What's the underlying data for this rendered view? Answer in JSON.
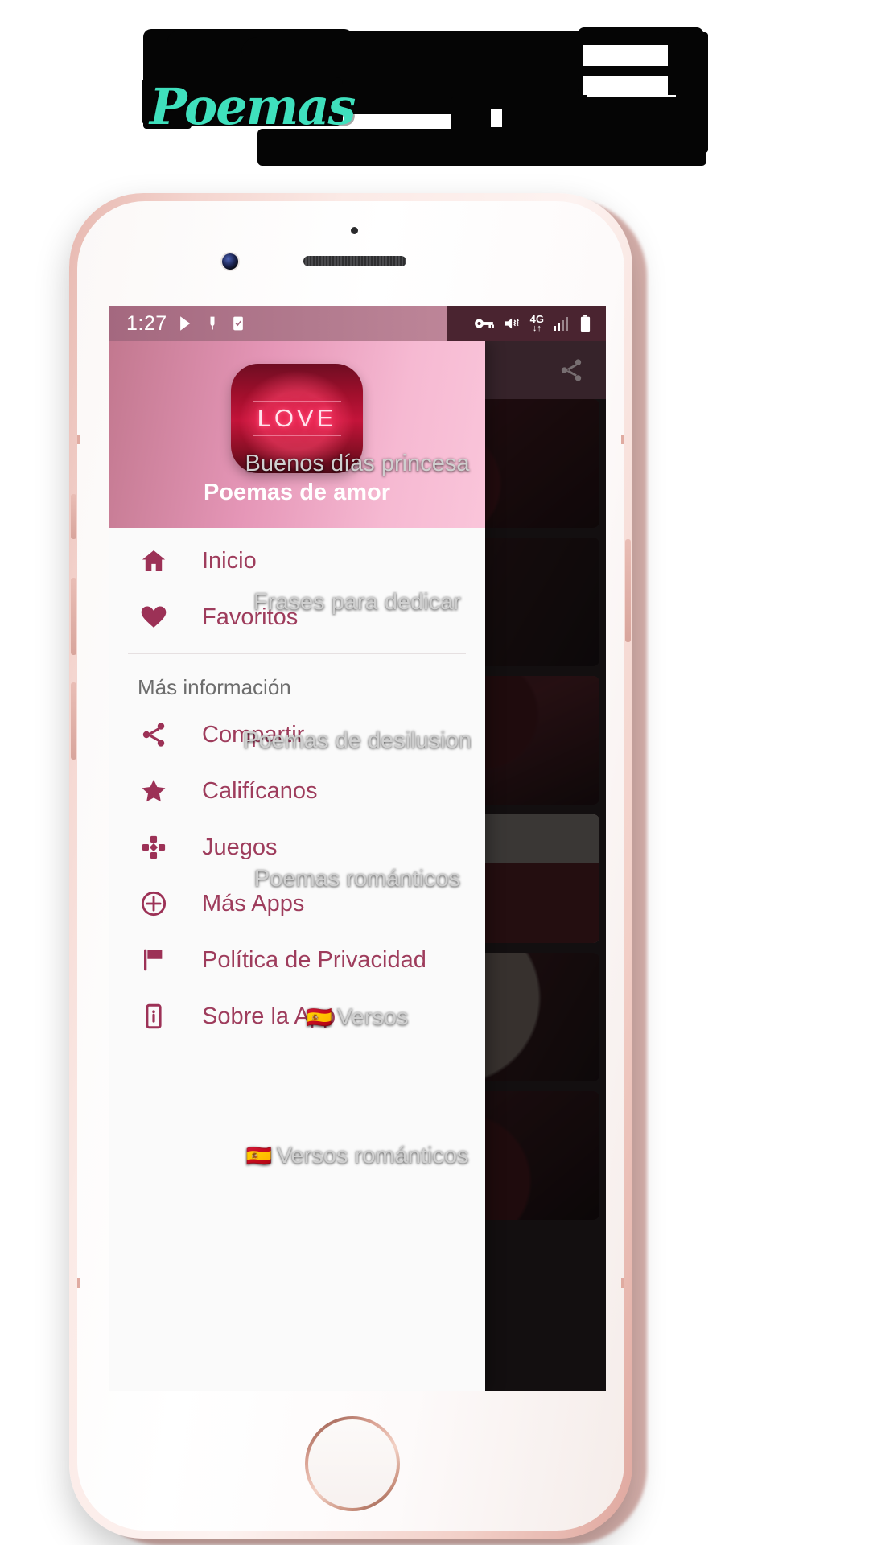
{
  "banner": {
    "script_text": "Poemas",
    "note": "obscured"
  },
  "statusbar": {
    "time": "1:27",
    "left_icons": [
      "play-store-icon",
      "usb-icon",
      "app-checkbox-icon"
    ],
    "right_icons": [
      "vpn-key-icon",
      "mute-icon",
      "mobile-data-4g-icon",
      "signal-bars-icon",
      "battery-icon"
    ],
    "network_label": "4G",
    "data_arrows": "↓↑"
  },
  "appbar": {
    "share_icon": "share-icon"
  },
  "drawer": {
    "app_icon_text": "LOVE",
    "app_name": "Poemas de amor",
    "primary_items": [
      {
        "label": "Inicio",
        "icon": "home-icon"
      },
      {
        "label": "Favoritos",
        "icon": "heart-icon"
      }
    ],
    "section_title": "Más información",
    "secondary_items": [
      {
        "label": "Compartir",
        "icon": "share-icon"
      },
      {
        "label": "Califícanos",
        "icon": "star-icon"
      },
      {
        "label": "Juegos",
        "icon": "gamepad-icon"
      },
      {
        "label": "Más Apps",
        "icon": "plus-circle-icon"
      },
      {
        "label": "Política de Privacidad",
        "icon": "flag-icon"
      },
      {
        "label": "Sobre la App",
        "icon": "info-phone-icon"
      }
    ]
  },
  "background_list": {
    "cards": [
      {
        "label": "Buenos días princesa",
        "flag": ""
      },
      {
        "label": "Frases para dedicar",
        "flag": ""
      },
      {
        "label": "Poemas de desilusion",
        "flag": ""
      },
      {
        "label": "Poemas románticos",
        "flag": ""
      },
      {
        "label": "Versos",
        "flag": "🇪🇸"
      },
      {
        "label": "Versos románticos",
        "flag": "🇪🇸"
      }
    ]
  },
  "colors": {
    "accent_pink": "#e596b7",
    "drawer_text": "#9e3c5c",
    "statusbar_left": "#a4687f",
    "statusbar_right": "#4a2430",
    "section_text": "#6d6d6d",
    "script_teal": "#3fe0bd"
  }
}
